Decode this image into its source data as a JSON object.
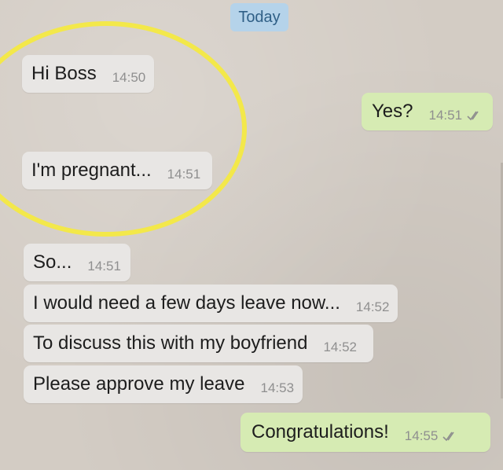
{
  "chat": {
    "date_label": "Today",
    "messages": [
      {
        "direction": "incoming",
        "text": "Hi Boss",
        "time": "14:50"
      },
      {
        "direction": "outgoing",
        "text": "Yes?",
        "time": "14:51",
        "status_icon": "double-check-icon"
      },
      {
        "direction": "incoming",
        "text": "I'm pregnant...",
        "time": "14:51"
      },
      {
        "direction": "incoming",
        "text": "So...",
        "time": "14:51"
      },
      {
        "direction": "incoming",
        "text": "I would need a few days leave now...",
        "time": "14:52"
      },
      {
        "direction": "incoming",
        "text": "To discuss this with my boyfriend",
        "time": "14:52"
      },
      {
        "direction": "incoming",
        "text": "Please approve my leave",
        "time": "14:53"
      },
      {
        "direction": "outgoing",
        "text": "Congratulations!",
        "time": "14:55",
        "status_icon": "double-check-icon"
      }
    ]
  },
  "colors": {
    "background": "#d3ccc4",
    "incoming_bubble": "#e8e6e4",
    "outgoing_bubble": "#d6ebb3",
    "date_chip": "#b5d3ea",
    "highlight_ellipse": "#f3e84a"
  }
}
